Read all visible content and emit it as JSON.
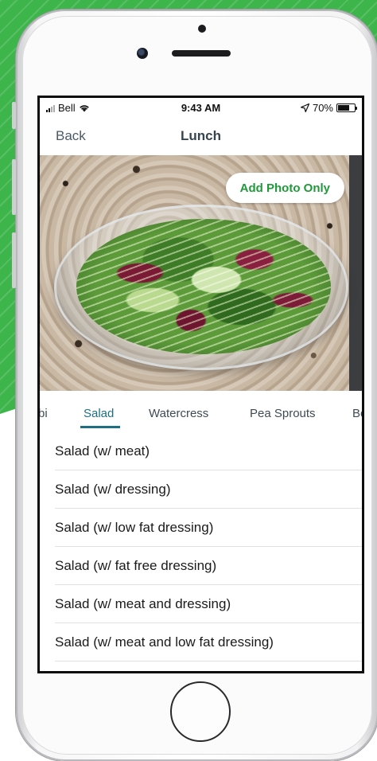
{
  "status_bar": {
    "carrier": "Bell",
    "time": "9:43 AM",
    "battery_percent": "70%",
    "battery_level": 0.7
  },
  "nav": {
    "back_label": "Back",
    "title": "Lunch"
  },
  "photo": {
    "add_photo_label": "Add Photo Only"
  },
  "tabs": [
    {
      "label": "bi"
    },
    {
      "label": "Salad",
      "active": true
    },
    {
      "label": "Watercress"
    },
    {
      "label": "Pea Sprouts"
    },
    {
      "label": "Be"
    }
  ],
  "items": [
    {
      "label": "Salad (w/ meat)"
    },
    {
      "label": "Salad (w/ dressing)"
    },
    {
      "label": "Salad (w/ low fat dressing)"
    },
    {
      "label": "Salad (w/ fat free dressing)"
    },
    {
      "label": "Salad (w/ meat and dressing)"
    },
    {
      "label": "Salad (w/ meat and low fat dressing)"
    }
  ],
  "colors": {
    "background_green": "#3db54a",
    "accent_teal": "#1e6f86",
    "button_green_text": "#1f9a3a"
  }
}
